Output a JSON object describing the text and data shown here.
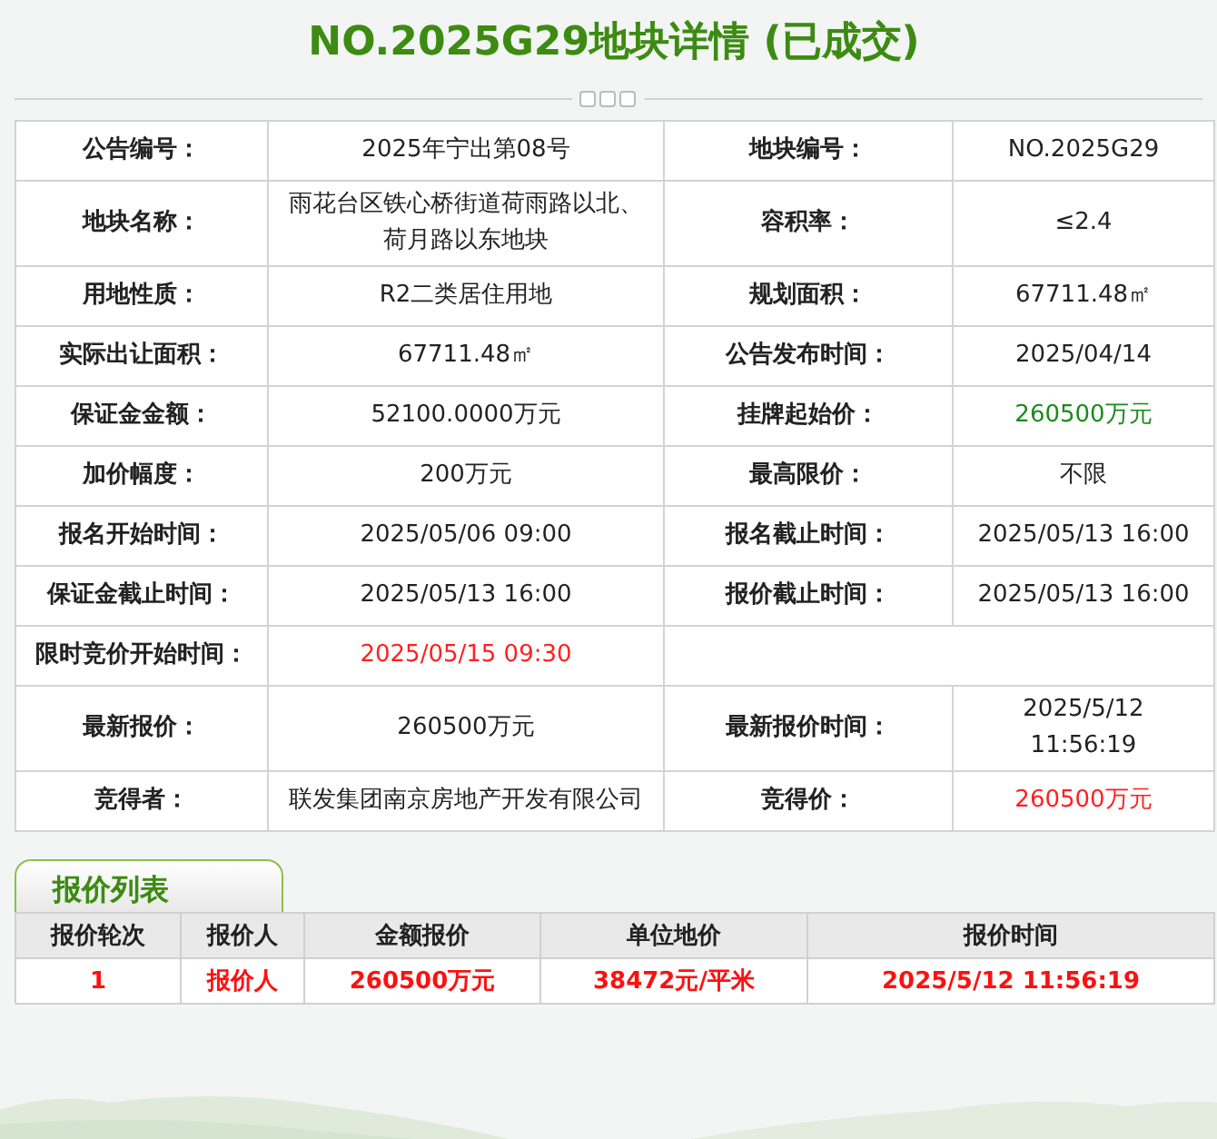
{
  "title": "NO.2025G29地块详情 (已成交)",
  "details": [
    {
      "pairs": [
        {
          "label": "公告编号：",
          "value": "2025年宁出第08号"
        },
        {
          "label": "地块编号：",
          "value": "NO.2025G29"
        }
      ]
    },
    {
      "pairs": [
        {
          "label": "地块名称：",
          "value": "雨花台区铁心桥街道荷雨路以北、荷月路以东地块"
        },
        {
          "label": "容积率：",
          "value": "≤2.4"
        }
      ]
    },
    {
      "pairs": [
        {
          "label": "用地性质：",
          "value": "R2二类居住用地"
        },
        {
          "label": "规划面积：",
          "value": "67711.48㎡"
        }
      ]
    },
    {
      "pairs": [
        {
          "label": "实际出让面积：",
          "value": "67711.48㎡"
        },
        {
          "label": "公告发布时间：",
          "value": "2025/04/14"
        }
      ]
    },
    {
      "pairs": [
        {
          "label": "保证金金额：",
          "value": "52100.0000万元"
        },
        {
          "label": "挂牌起始价：",
          "value": "260500万元",
          "color": "#1a8a1a"
        }
      ]
    },
    {
      "pairs": [
        {
          "label": "加价幅度：",
          "value": "200万元"
        },
        {
          "label": "最高限价：",
          "value": "不限"
        }
      ]
    },
    {
      "pairs": [
        {
          "label": "报名开始时间：",
          "value": "2025/05/06 09:00"
        },
        {
          "label": "报名截止时间：",
          "value": "2025/05/13 16:00"
        }
      ]
    },
    {
      "pairs": [
        {
          "label": "保证金截止时间：",
          "value": "2025/05/13 16:00"
        },
        {
          "label": "报价截止时间：",
          "value": "2025/05/13 16:00"
        }
      ]
    },
    {
      "pairs": [
        {
          "label": "限时竞价开始时间：",
          "value": "2025/05/15 09:30",
          "color": "#ff2020"
        }
      ]
    },
    {
      "pairs": [
        {
          "label": "最新报价：",
          "value": "260500万元"
        },
        {
          "label": "最新报价时间：",
          "value": "2025/5/12 11:56:19"
        }
      ]
    },
    {
      "pairs": [
        {
          "label": "竞得者：",
          "value": "联发集团南京房地产开发有限公司"
        },
        {
          "label": "竞得价：",
          "value": "260500万元",
          "color": "#ff2020"
        }
      ]
    }
  ],
  "bids": {
    "tab": "报价列表",
    "columns": [
      "报价轮次",
      "报价人",
      "金额报价",
      "单位地价",
      "报价时间"
    ],
    "rows": [
      [
        "1",
        "报价人",
        "260500万元",
        "38472元/平米",
        "2025/5/12 11:56:19"
      ]
    ]
  }
}
